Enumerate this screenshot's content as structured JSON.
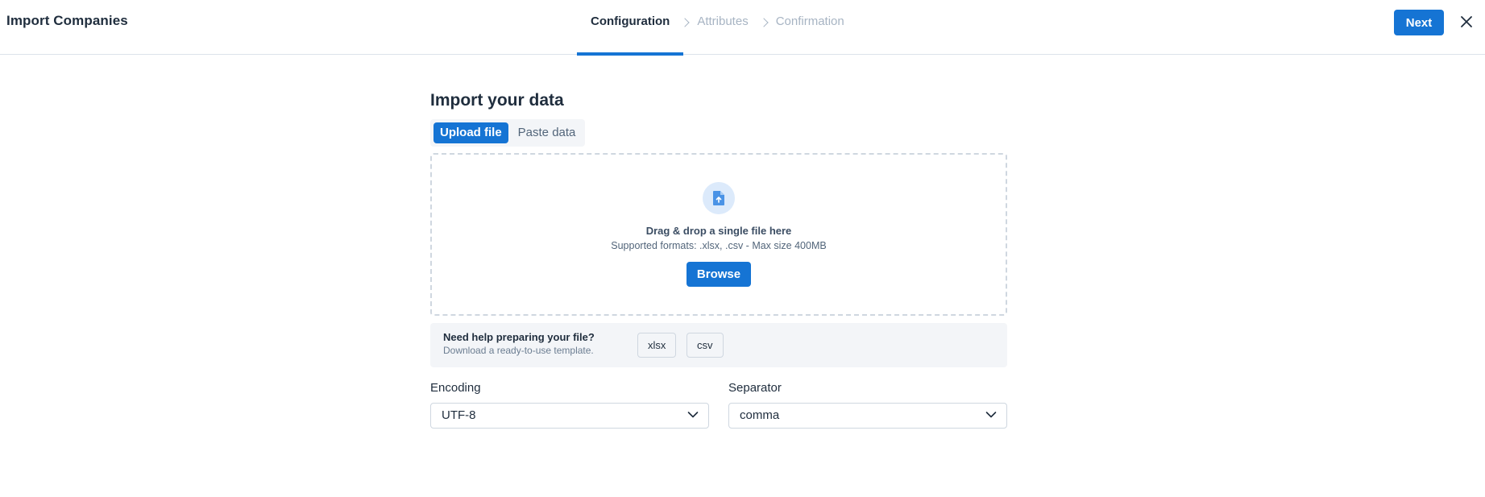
{
  "header": {
    "title": "Import Companies",
    "steps": [
      {
        "label": "Configuration",
        "active": true
      },
      {
        "label": "Attributes",
        "active": false
      },
      {
        "label": "Confirmation",
        "active": false
      }
    ],
    "next_label": "Next",
    "close_icon": "close-icon",
    "step_separator_icon": "chevron-right-icon"
  },
  "main": {
    "title": "Import your data",
    "tabs": [
      {
        "label": "Upload file",
        "active": true
      },
      {
        "label": "Paste data",
        "active": false
      }
    ],
    "dropzone": {
      "icon": "file-upload-icon",
      "title": "Drag & drop a single file here",
      "subtitle": "Supported formats: .xlsx, .csv - Max size 400MB",
      "browse_label": "Browse"
    },
    "help": {
      "title": "Need help preparing your file?",
      "subtitle": "Download a ready-to-use template.",
      "templates": [
        "xlsx",
        "csv"
      ]
    },
    "encoding": {
      "label": "Encoding",
      "value": "UTF-8"
    },
    "separator": {
      "label": "Separator",
      "value": "comma"
    }
  },
  "colors": {
    "accent": "#1574d4",
    "text": "#1f2d3d",
    "muted": "#a7b4c3",
    "panel": "#f3f5f8",
    "border": "#cfd7e0"
  }
}
